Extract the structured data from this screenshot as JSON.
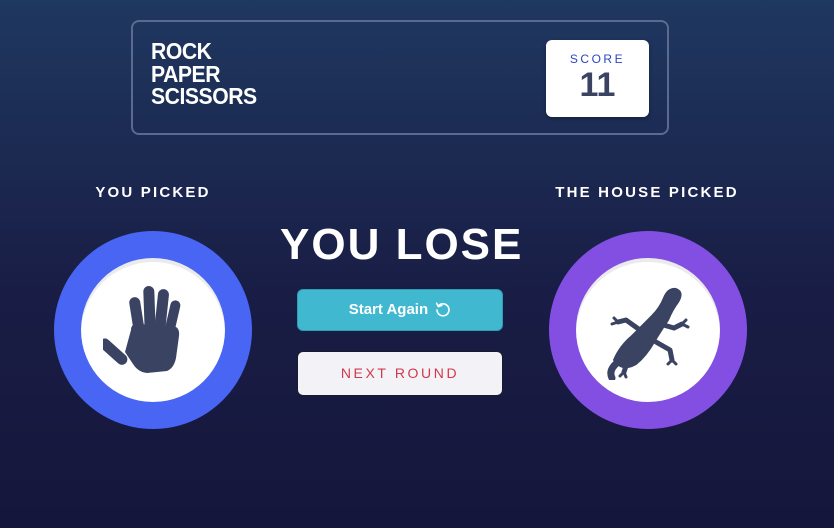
{
  "header": {
    "title_lines": [
      "ROCK",
      "PAPER",
      "SCISSORS"
    ],
    "score_label": "SCORE",
    "score_value": "11"
  },
  "player": {
    "label": "YOU PICKED",
    "choice": "paper",
    "icon": "hand-icon",
    "ring_color": "#4865f4"
  },
  "house": {
    "label": "THE HOUSE PICKED",
    "choice": "lizard",
    "icon": "lizard-icon",
    "ring_color": "#834fe3"
  },
  "result": {
    "text": "YOU LOSE"
  },
  "buttons": {
    "start_again": "Start Again",
    "start_again_icon": "restart-icon",
    "next_round": "NEXT ROUND"
  },
  "colors": {
    "start_button": "#40b9d0",
    "next_round_text": "#d2384d",
    "score_label": "#2a46c0",
    "icon_fill": "#3b4363"
  }
}
